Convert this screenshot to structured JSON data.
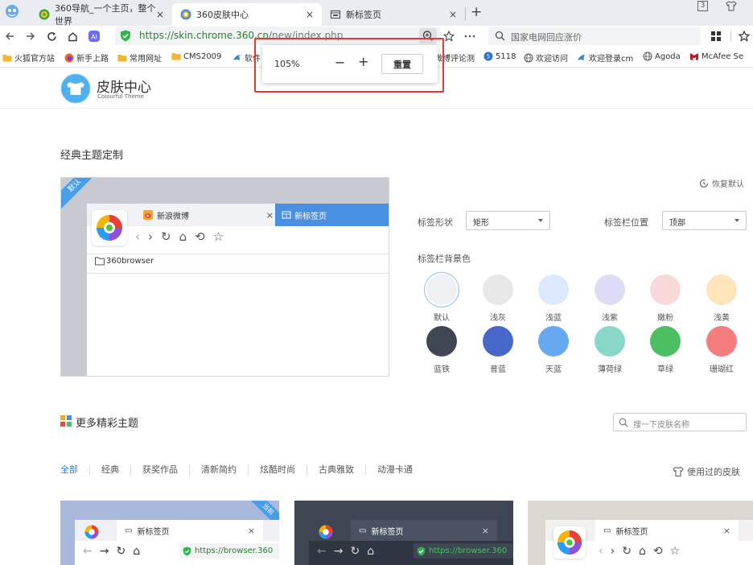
{
  "tabs": [
    {
      "title": "360导航_一个主页，整个世界",
      "close": "×"
    },
    {
      "title": "360皮肤中心",
      "close": "×"
    },
    {
      "title": "新标签页",
      "close": "×"
    }
  ],
  "new_tab": "+",
  "window_controls": {
    "count": "3"
  },
  "address": {
    "url_secure": "https://",
    "url_host": "skin.chrome.360.cn",
    "url_path": "/new/index.php"
  },
  "search": {
    "query": "国家电网回应涨价"
  },
  "bookmarks": [
    {
      "label": "火狐官方站",
      "icon": "folder-icon"
    },
    {
      "label": "新手上路",
      "icon": "firefox-icon"
    },
    {
      "label": "常用网址",
      "icon": "folder-icon"
    },
    {
      "label": "CMS2009",
      "icon": "folder-icon"
    },
    {
      "label": "软件",
      "icon": "bird-icon"
    },
    {
      "label": "微博评论测",
      "icon": "bird-icon"
    },
    {
      "label": "5118",
      "icon": "5118-icon"
    },
    {
      "label": "欢迎访问",
      "icon": "globe-icon"
    },
    {
      "label": "欢迎登录cm",
      "icon": "bird-icon"
    },
    {
      "label": "Agoda",
      "icon": "globe-icon"
    },
    {
      "label": "McAfee Se",
      "icon": "mcafee-icon"
    }
  ],
  "zoom_popup": {
    "value": "105%",
    "minus": "−",
    "plus": "+",
    "reset": "重置"
  },
  "site": {
    "title": "皮肤中心",
    "subtitle": "Colourful Theme"
  },
  "classic": {
    "title": "经典主题定制",
    "default_ribbon": "默认",
    "preview": {
      "tab1": "新浪微博",
      "tab2": "新标签页",
      "bookmark": "360browser",
      "close": "×"
    },
    "restore": "恢复默认",
    "tab_shape": {
      "label": "标签形状",
      "value": "矩形"
    },
    "tab_position": {
      "label": "标签栏位置",
      "value": "顶部"
    },
    "bg_label": "标签栏背景色",
    "colors": [
      {
        "name": "默认",
        "color": "#eef0f3"
      },
      {
        "name": "浅灰",
        "color": "#e8e8e8"
      },
      {
        "name": "浅蓝",
        "color": "#dce8fb"
      },
      {
        "name": "浅紫",
        "color": "#dcdcf7"
      },
      {
        "name": "嫩粉",
        "color": "#f8d8d8"
      },
      {
        "name": "浅黄",
        "color": "#fde4bb"
      },
      {
        "name": "蓝铁",
        "color": "#3f4654"
      },
      {
        "name": "普蓝",
        "color": "#4768c8"
      },
      {
        "name": "天蓝",
        "color": "#67a9f0"
      },
      {
        "name": "薄荷绿",
        "color": "#88d7c7"
      },
      {
        "name": "草绿",
        "color": "#4dbf62"
      },
      {
        "name": "珊瑚红",
        "color": "#f57c7c"
      }
    ]
  },
  "more": {
    "title": "更多精彩主题",
    "search_placeholder": "搜一下皮肤名称",
    "categories": [
      "全部",
      "经典",
      "获奖作品",
      "清新简约",
      "炫酷时尚",
      "古典雅致",
      "动漫卡通"
    ],
    "used": "使用过的皮肤",
    "cards": [
      {
        "tab": "新标签页",
        "url": "https://browser.360",
        "ribbon": "当前",
        "close": "×"
      },
      {
        "tab": "新标签页",
        "url": "https://browser.360",
        "close": "×"
      },
      {
        "tab": "新标签页",
        "close": "×"
      }
    ]
  }
}
